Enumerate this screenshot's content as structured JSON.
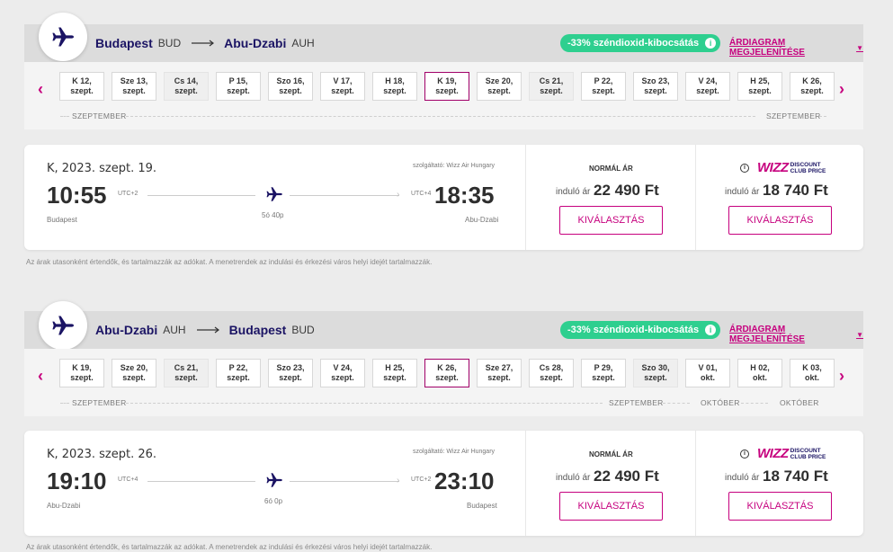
{
  "outbound": {
    "origin_city": "Budapest",
    "origin_code": "BUD",
    "dest_city": "Abu-Dzabi",
    "dest_code": "AUH",
    "co2_label": "-33% széndioxid-kibocsátás",
    "chart_link": "ÁRDIAGRAM MEGJELENÍTÉSE",
    "dates": [
      {
        "d": "K 12,",
        "m": "szept."
      },
      {
        "d": "Sze 13,",
        "m": "szept."
      },
      {
        "d": "Cs 14,",
        "m": "szept."
      },
      {
        "d": "P 15,",
        "m": "szept."
      },
      {
        "d": "Szo 16,",
        "m": "szept."
      },
      {
        "d": "V 17,",
        "m": "szept."
      },
      {
        "d": "H 18,",
        "m": "szept."
      },
      {
        "d": "K 19,",
        "m": "szept."
      },
      {
        "d": "Sze 20,",
        "m": "szept."
      },
      {
        "d": "Cs 21,",
        "m": "szept."
      },
      {
        "d": "P 22,",
        "m": "szept."
      },
      {
        "d": "Szo 23,",
        "m": "szept."
      },
      {
        "d": "V 24,",
        "m": "szept."
      },
      {
        "d": "H 25,",
        "m": "szept."
      },
      {
        "d": "K 26,",
        "m": "szept."
      }
    ],
    "month_left": "SZEPTEMBER",
    "month_right": "SZEPTEMBER",
    "flight_date": "K, 2023. szept. 19.",
    "operator": "szolgáltató: Wizz Air Hungary",
    "dep_time": "10:55",
    "dep_utc": "UTC+2",
    "arr_time": "18:35",
    "arr_utc": "UTC+4",
    "duration": "5ó 40p",
    "dep_place": "Budapest",
    "arr_place": "Abu-Dzabi"
  },
  "inbound": {
    "origin_city": "Abu-Dzabi",
    "origin_code": "AUH",
    "dest_city": "Budapest",
    "dest_code": "BUD",
    "co2_label": "-33% széndioxid-kibocsátás",
    "chart_link": "ÁRDIAGRAM MEGJELENÍTÉSE",
    "dates": [
      {
        "d": "K 19,",
        "m": "szept."
      },
      {
        "d": "Sze 20,",
        "m": "szept."
      },
      {
        "d": "Cs 21,",
        "m": "szept."
      },
      {
        "d": "P 22,",
        "m": "szept."
      },
      {
        "d": "Szo 23,",
        "m": "szept."
      },
      {
        "d": "V 24,",
        "m": "szept."
      },
      {
        "d": "H 25,",
        "m": "szept."
      },
      {
        "d": "K 26,",
        "m": "szept."
      },
      {
        "d": "Sze 27,",
        "m": "szept."
      },
      {
        "d": "Cs 28,",
        "m": "szept."
      },
      {
        "d": "P 29,",
        "m": "szept."
      },
      {
        "d": "Szo 30,",
        "m": "szept."
      },
      {
        "d": "V 01,",
        "m": "okt."
      },
      {
        "d": "H 02,",
        "m": "okt."
      },
      {
        "d": "K 03,",
        "m": "okt."
      }
    ],
    "month_left": "SZEPTEMBER",
    "month_mid_a": "SZEPTEMBER",
    "month_mid_b": "OKTÓBER",
    "month_right": "OKTÓBER",
    "flight_date": "K, 2023. szept. 26.",
    "operator": "szolgáltató: Wizz Air Hungary",
    "dep_time": "19:10",
    "dep_utc": "UTC+4",
    "arr_time": "23:10",
    "arr_utc": "UTC+2",
    "duration": "6ó 0p",
    "dep_place": "Abu-Dzabi",
    "arr_place": "Budapest"
  },
  "fares": {
    "normal_title": "NORMÁL ÁR",
    "from_label": "induló ár",
    "normal_price": "22 490 Ft",
    "club_price": "18 740 Ft",
    "select_label": "KIVÁLASZTÁS",
    "wizz_logo": "WIZZ",
    "club_line1": "DISCOUNT",
    "club_line2": "CLUB PRICE"
  },
  "note": "Az árak utasonként értendők, és tartalmazzák az adókat. A menetrendek az indulási és érkezési város helyi idejét tartalmazzák.",
  "colors": {
    "brand": "#c6007e",
    "navy": "#1b1464",
    "co2": "#2ecf8f"
  },
  "icons": {
    "logo": "airplane-icon",
    "info": "info-icon",
    "prev": "chevron-left-icon",
    "next": "chevron-right-icon"
  }
}
